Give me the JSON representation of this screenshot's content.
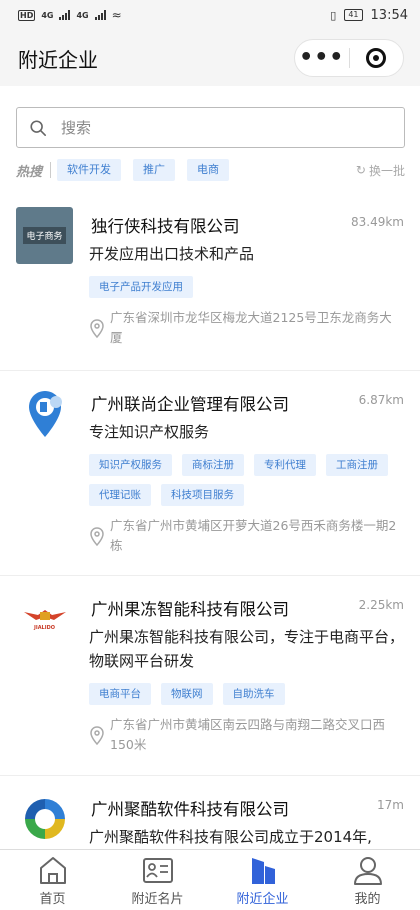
{
  "status_bar": {
    "left": "HD",
    "net1": "4G",
    "net2": "4G",
    "battery": "41",
    "time": "13:54"
  },
  "header": {
    "title": "附近企业",
    "more_label": "•••"
  },
  "search": {
    "placeholder": "搜索"
  },
  "hot": {
    "label": "热搜",
    "tags": [
      "软件开发",
      "推广",
      "电商"
    ],
    "refresh_label": "换一批"
  },
  "companies": [
    {
      "name": "独行侠科技有限公司",
      "distance": "83.49km",
      "desc": "开发应用出口技术和产品",
      "tags": [
        "电子产品开发应用"
      ],
      "address": "广东省深圳市龙华区梅龙大道2125号卫东龙商务大厦",
      "logo": "电子商务"
    },
    {
      "name": "广州联尚企业管理有限公司",
      "distance": "6.87km",
      "desc": "专注知识产权服务",
      "tags": [
        "知识产权服务",
        "商标注册",
        "专利代理",
        "工商注册",
        "代理记账",
        "科技项目服务"
      ],
      "address": "广东省广州市黄埔区开萝大道26号西禾商务楼一期2栋"
    },
    {
      "name": "广州果冻智能科技有限公司",
      "distance": "2.25km",
      "desc": "广州果冻智能科技有限公司，专注于电商平台，物联网平台研发",
      "tags": [
        "电商平台",
        "物联网",
        "自助洗车"
      ],
      "address": "广东省广州市黄埔区南云四路与南翔二路交叉口西150米",
      "logo": "JIALIDO"
    },
    {
      "name": "广州聚酷软件科技有限公司",
      "distance": "17m",
      "desc": "广州聚酷软件科技有限公司成立于2014年,"
    }
  ],
  "nav": [
    {
      "label": "首页",
      "icon": "home-icon"
    },
    {
      "label": "附近名片",
      "icon": "card-icon"
    },
    {
      "label": "附近企业",
      "icon": "building-icon"
    },
    {
      "label": "我的",
      "icon": "user-icon"
    }
  ],
  "colors": {
    "accent": "#3162d9",
    "tag_bg": "#e8f1fd",
    "tag_text": "#3f7fd0"
  }
}
